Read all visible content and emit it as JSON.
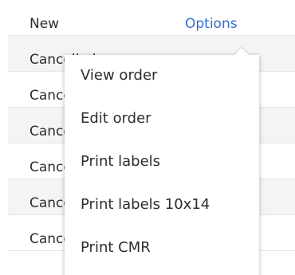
{
  "table": {
    "rows": [
      {
        "status": "New",
        "action": "Options"
      },
      {
        "status": "Cancelled"
      },
      {
        "status": "Cancelled"
      },
      {
        "status": "Cancelled"
      },
      {
        "status": "Cancelled"
      },
      {
        "status": "Cancelled"
      },
      {
        "status": "Cancelled"
      }
    ]
  },
  "options_menu": {
    "items": [
      {
        "label": "View order"
      },
      {
        "label": "Edit order"
      },
      {
        "label": "Print labels"
      },
      {
        "label": "Print labels 10x14"
      },
      {
        "label": "Print CMR"
      }
    ]
  }
}
